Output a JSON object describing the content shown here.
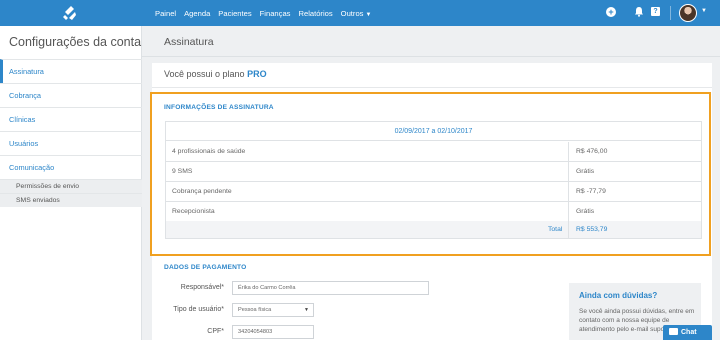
{
  "topbar": {
    "nav": [
      "Painel",
      "Agenda",
      "Pacientes",
      "Finanças",
      "Relatórios",
      "Outros"
    ],
    "icons": [
      "plus-icon",
      "bell-icon",
      "help-icon",
      "avatar"
    ],
    "brand_color": "#2d86c9"
  },
  "sidebar": {
    "title": "Configurações da conta",
    "items": [
      {
        "label": "Assinatura",
        "active": true
      },
      {
        "label": "Cobrança"
      },
      {
        "label": "Clínicas"
      },
      {
        "label": "Usuários"
      },
      {
        "label": "Comunicação"
      }
    ],
    "subitems": [
      "Permissões de envio",
      "SMS enviados"
    ]
  },
  "main": {
    "page_title": "Assinatura",
    "plan_prefix": "Você possui o plano",
    "plan_name": "PRO",
    "info": {
      "title": "INFORMAÇÕES DE ASSINATURA",
      "period": "02/09/2017 a 02/10/2017",
      "rows": [
        {
          "desc": "4 profissionais de saúde",
          "value": "R$ 476,00"
        },
        {
          "desc": "9 SMS",
          "value": "Grátis"
        },
        {
          "desc": "Cobrança pendente",
          "value": "R$ -77,79"
        },
        {
          "desc": "Recepcionista",
          "value": "Grátis"
        }
      ],
      "total_label": "Total",
      "total_value": "R$ 553,79"
    },
    "payment": {
      "title": "DADOS DE PAGAMENTO",
      "responsavel_label": "Responsável*",
      "responsavel_value": "Érika do Carmo Corrêa",
      "tipo_label": "Tipo de usuário*",
      "tipo_value": "Pessoa física",
      "cpf_label": "CPF*",
      "cpf_value": "34204054803"
    },
    "help": {
      "title": "Ainda com dúvidas?",
      "text": "Se você ainda possui dúvidas, entre em contato com a nossa equipe de atendimento pelo e-mail suporte@iclinic"
    }
  },
  "chat": {
    "label": "Chat"
  },
  "colors": {
    "highlight": "#f0a020",
    "link": "#2d86c9"
  }
}
